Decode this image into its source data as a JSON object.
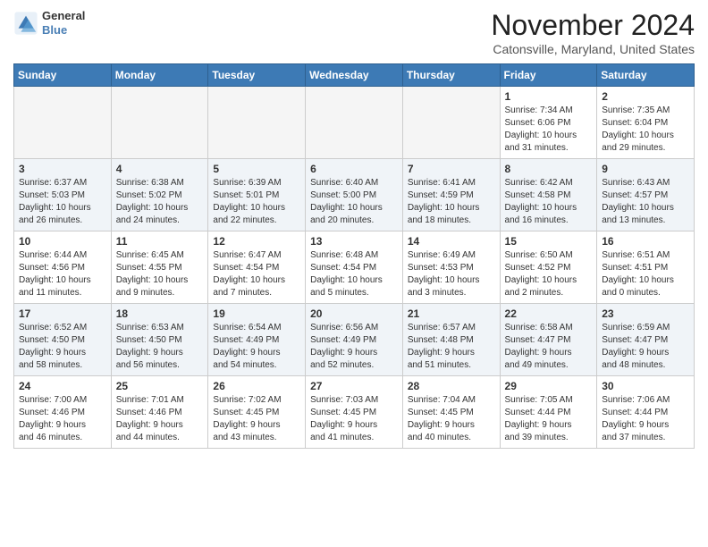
{
  "header": {
    "logo_line1": "General",
    "logo_line2": "Blue",
    "month_title": "November 2024",
    "location": "Catonsville, Maryland, United States"
  },
  "weekdays": [
    "Sunday",
    "Monday",
    "Tuesday",
    "Wednesday",
    "Thursday",
    "Friday",
    "Saturday"
  ],
  "weeks": [
    [
      {
        "day": "",
        "info": ""
      },
      {
        "day": "",
        "info": ""
      },
      {
        "day": "",
        "info": ""
      },
      {
        "day": "",
        "info": ""
      },
      {
        "day": "",
        "info": ""
      },
      {
        "day": "1",
        "info": "Sunrise: 7:34 AM\nSunset: 6:06 PM\nDaylight: 10 hours\nand 31 minutes."
      },
      {
        "day": "2",
        "info": "Sunrise: 7:35 AM\nSunset: 6:04 PM\nDaylight: 10 hours\nand 29 minutes."
      }
    ],
    [
      {
        "day": "3",
        "info": "Sunrise: 6:37 AM\nSunset: 5:03 PM\nDaylight: 10 hours\nand 26 minutes."
      },
      {
        "day": "4",
        "info": "Sunrise: 6:38 AM\nSunset: 5:02 PM\nDaylight: 10 hours\nand 24 minutes."
      },
      {
        "day": "5",
        "info": "Sunrise: 6:39 AM\nSunset: 5:01 PM\nDaylight: 10 hours\nand 22 minutes."
      },
      {
        "day": "6",
        "info": "Sunrise: 6:40 AM\nSunset: 5:00 PM\nDaylight: 10 hours\nand 20 minutes."
      },
      {
        "day": "7",
        "info": "Sunrise: 6:41 AM\nSunset: 4:59 PM\nDaylight: 10 hours\nand 18 minutes."
      },
      {
        "day": "8",
        "info": "Sunrise: 6:42 AM\nSunset: 4:58 PM\nDaylight: 10 hours\nand 16 minutes."
      },
      {
        "day": "9",
        "info": "Sunrise: 6:43 AM\nSunset: 4:57 PM\nDaylight: 10 hours\nand 13 minutes."
      }
    ],
    [
      {
        "day": "10",
        "info": "Sunrise: 6:44 AM\nSunset: 4:56 PM\nDaylight: 10 hours\nand 11 minutes."
      },
      {
        "day": "11",
        "info": "Sunrise: 6:45 AM\nSunset: 4:55 PM\nDaylight: 10 hours\nand 9 minutes."
      },
      {
        "day": "12",
        "info": "Sunrise: 6:47 AM\nSunset: 4:54 PM\nDaylight: 10 hours\nand 7 minutes."
      },
      {
        "day": "13",
        "info": "Sunrise: 6:48 AM\nSunset: 4:54 PM\nDaylight: 10 hours\nand 5 minutes."
      },
      {
        "day": "14",
        "info": "Sunrise: 6:49 AM\nSunset: 4:53 PM\nDaylight: 10 hours\nand 3 minutes."
      },
      {
        "day": "15",
        "info": "Sunrise: 6:50 AM\nSunset: 4:52 PM\nDaylight: 10 hours\nand 2 minutes."
      },
      {
        "day": "16",
        "info": "Sunrise: 6:51 AM\nSunset: 4:51 PM\nDaylight: 10 hours\nand 0 minutes."
      }
    ],
    [
      {
        "day": "17",
        "info": "Sunrise: 6:52 AM\nSunset: 4:50 PM\nDaylight: 9 hours\nand 58 minutes."
      },
      {
        "day": "18",
        "info": "Sunrise: 6:53 AM\nSunset: 4:50 PM\nDaylight: 9 hours\nand 56 minutes."
      },
      {
        "day": "19",
        "info": "Sunrise: 6:54 AM\nSunset: 4:49 PM\nDaylight: 9 hours\nand 54 minutes."
      },
      {
        "day": "20",
        "info": "Sunrise: 6:56 AM\nSunset: 4:49 PM\nDaylight: 9 hours\nand 52 minutes."
      },
      {
        "day": "21",
        "info": "Sunrise: 6:57 AM\nSunset: 4:48 PM\nDaylight: 9 hours\nand 51 minutes."
      },
      {
        "day": "22",
        "info": "Sunrise: 6:58 AM\nSunset: 4:47 PM\nDaylight: 9 hours\nand 49 minutes."
      },
      {
        "day": "23",
        "info": "Sunrise: 6:59 AM\nSunset: 4:47 PM\nDaylight: 9 hours\nand 48 minutes."
      }
    ],
    [
      {
        "day": "24",
        "info": "Sunrise: 7:00 AM\nSunset: 4:46 PM\nDaylight: 9 hours\nand 46 minutes."
      },
      {
        "day": "25",
        "info": "Sunrise: 7:01 AM\nSunset: 4:46 PM\nDaylight: 9 hours\nand 44 minutes."
      },
      {
        "day": "26",
        "info": "Sunrise: 7:02 AM\nSunset: 4:45 PM\nDaylight: 9 hours\nand 43 minutes."
      },
      {
        "day": "27",
        "info": "Sunrise: 7:03 AM\nSunset: 4:45 PM\nDaylight: 9 hours\nand 41 minutes."
      },
      {
        "day": "28",
        "info": "Sunrise: 7:04 AM\nSunset: 4:45 PM\nDaylight: 9 hours\nand 40 minutes."
      },
      {
        "day": "29",
        "info": "Sunrise: 7:05 AM\nSunset: 4:44 PM\nDaylight: 9 hours\nand 39 minutes."
      },
      {
        "day": "30",
        "info": "Sunrise: 7:06 AM\nSunset: 4:44 PM\nDaylight: 9 hours\nand 37 minutes."
      }
    ]
  ]
}
